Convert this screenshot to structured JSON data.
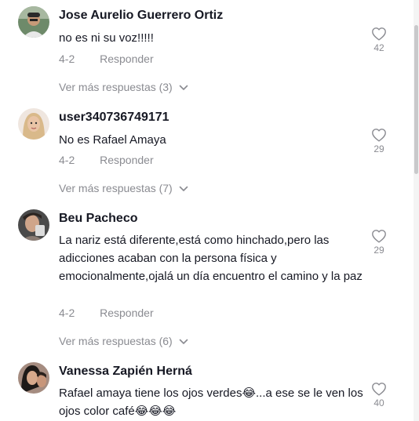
{
  "comments": [
    {
      "username": "Jose Aurelio Guerrero Ortiz",
      "text": "no es ni su voz!!!!!",
      "date": "4-2",
      "reply_label": "Responder",
      "likes": "42",
      "more_replies": "Ver más respuestas (3)"
    },
    {
      "username": "user340736749171",
      "text": "No es Rafael Amaya",
      "date": "4-2",
      "reply_label": "Responder",
      "likes": "29",
      "more_replies": "Ver más respuestas (7)"
    },
    {
      "username": "Beu Pacheco",
      "text": "La nariz está diferente,está como hinchado,pero las adicciones acaban con la persona física y emocionalmente,ojalá un día encuentro el camino y la paz",
      "date": "4-2",
      "reply_label": "Responder",
      "likes": "29",
      "more_replies": "Ver más respuestas (6)"
    },
    {
      "username": "Vanessa Zapién Herná",
      "text": "Rafael amaya tiene los ojos verdes😂...a ese se le ven los ojos color café😂😂😂",
      "likes": "40"
    }
  ],
  "icons": {
    "like": "heart-outline-icon",
    "expand": "chevron-down-icon"
  },
  "colors": {
    "text": "#161823",
    "muted": "#8a8b91"
  }
}
